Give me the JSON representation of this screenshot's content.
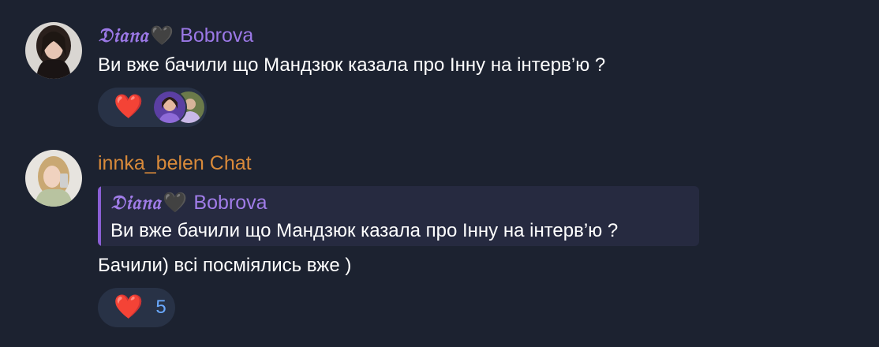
{
  "colors": {
    "background": "#1c2230",
    "reaction_bg": "#283246",
    "purple_name": "#9b78e6",
    "orange_name": "#d98a3a",
    "quote_bar": "#8b5fd6",
    "heart_red": "#f02f42",
    "count_blue": "#6aa9ff"
  },
  "messages": [
    {
      "sender_deco": "𝔇𝔦𝔞𝔫𝔞",
      "sender_emoji": "🖤",
      "sender_name": "Bobrova",
      "text": "Ви вже бачили що Мандзюк казала про Інну на інтерв’ю ?",
      "reaction": {
        "emoji": "❤️",
        "icon": "red-heart-icon",
        "reactor_avatars": [
          "reactor-avatar-1",
          "reactor-avatar-2"
        ]
      }
    },
    {
      "sender_name": "innka_belen Chat",
      "reply_to": {
        "sender_deco": "𝔇𝔦𝔞𝔫𝔞",
        "sender_emoji": "🖤",
        "sender_name": "Bobrova",
        "text": "Ви вже бачили що Мандзюк казала про Інну на інтерв’ю ?"
      },
      "text": "Бачили) всі посміялись вже )",
      "reaction": {
        "emoji": "❤️",
        "icon": "red-heart-icon",
        "count": "5"
      }
    }
  ]
}
